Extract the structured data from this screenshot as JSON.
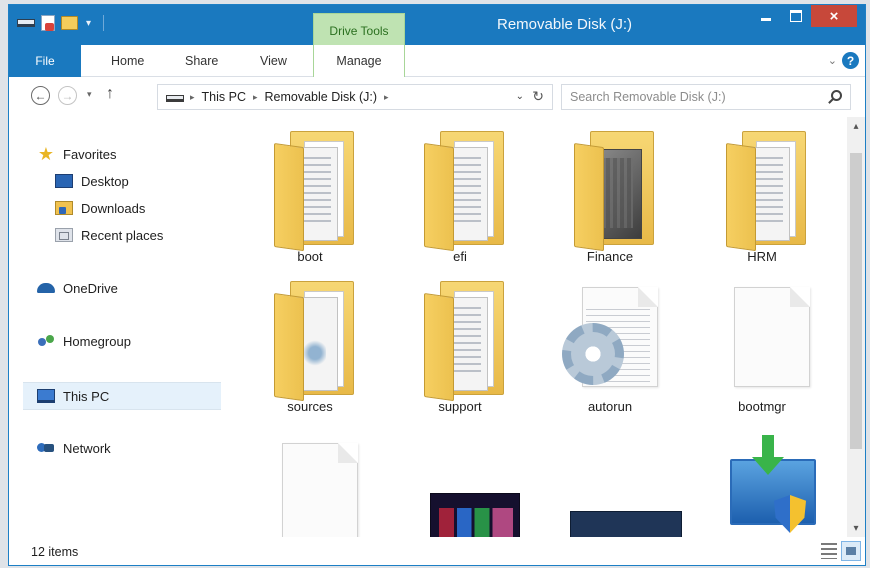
{
  "window": {
    "title": "Removable Disk (J:)",
    "context_tab": "Drive Tools",
    "close_glyph": "×"
  },
  "ribbon": {
    "tabs": [
      "File",
      "Home",
      "Share",
      "View",
      "Manage"
    ],
    "expand_glyph": "⌄",
    "help_glyph": "?"
  },
  "address": {
    "back_glyph": "←",
    "forward_glyph": "→",
    "recent_glyph": "▾",
    "up_glyph": "↑",
    "breadcrumbs": [
      "This PC",
      "Removable Disk (J:)"
    ],
    "separator_glyph": "▸",
    "dropdown_glyph": "⌄",
    "refresh_glyph": "↻"
  },
  "search": {
    "placeholder": "Search Removable Disk (J:)"
  },
  "nav": {
    "items": [
      {
        "label": "Favorites",
        "icon": "star-icon"
      },
      {
        "label": "Desktop",
        "icon": "desktop-icon"
      },
      {
        "label": "Downloads",
        "icon": "downloads-icon"
      },
      {
        "label": "Recent places",
        "icon": "recent-places-icon"
      },
      {
        "label": "OneDrive",
        "icon": "onedrive-icon"
      },
      {
        "label": "Homegroup",
        "icon": "homegroup-icon"
      },
      {
        "label": "This PC",
        "icon": "this-pc-icon",
        "selected": true
      },
      {
        "label": "Network",
        "icon": "network-icon"
      }
    ],
    "star_glyph": "★"
  },
  "files": [
    {
      "name": "boot",
      "type": "folder"
    },
    {
      "name": "efi",
      "type": "folder"
    },
    {
      "name": "Finance",
      "type": "folder"
    },
    {
      "name": "HRM",
      "type": "folder"
    },
    {
      "name": "sources",
      "type": "folder"
    },
    {
      "name": "support",
      "type": "folder"
    },
    {
      "name": "autorun",
      "type": "setup-information"
    },
    {
      "name": "bootmgr",
      "type": "file"
    },
    {
      "name": "",
      "type": "file"
    },
    {
      "name": "",
      "type": "image"
    },
    {
      "name": "",
      "type": "image"
    },
    {
      "name": "",
      "type": "installer"
    }
  ],
  "scrollbar": {
    "up_glyph": "▴",
    "down_glyph": "▾"
  },
  "status": {
    "item_count": "12 items"
  },
  "colors": {
    "title_bar": "#1a79bf",
    "context_tab": "#bfe3b2",
    "close_button": "#c7483a",
    "folder": "#f7d774"
  }
}
